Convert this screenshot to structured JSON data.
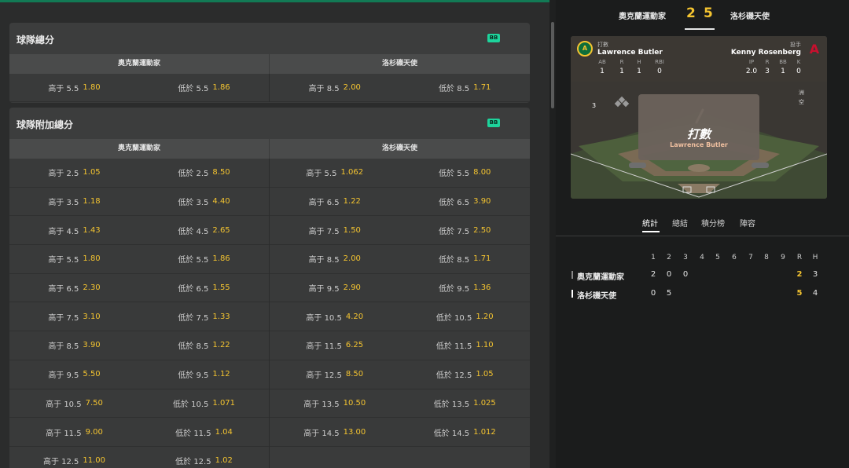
{
  "team_total": {
    "title": "球隊總分",
    "badge": "BB",
    "teams": [
      "奧克蘭運動家",
      "洛杉磯天使"
    ],
    "rows": [
      [
        {
          "label": "高于 5.5",
          "odd": "1.80"
        },
        {
          "label": "低於 5.5",
          "odd": "1.86"
        },
        {
          "label": "高于 8.5",
          "odd": "2.00"
        },
        {
          "label": "低於 8.5",
          "odd": "1.71"
        }
      ]
    ]
  },
  "team_extra_total": {
    "title": "球隊附加總分",
    "badge": "BB",
    "teams": [
      "奧克蘭運動家",
      "洛杉磯天使"
    ],
    "left_rows": [
      [
        {
          "label": "高于 2.5",
          "odd": "1.05"
        },
        {
          "label": "低於 2.5",
          "odd": "8.50"
        }
      ],
      [
        {
          "label": "高于 3.5",
          "odd": "1.18"
        },
        {
          "label": "低於 3.5",
          "odd": "4.40"
        }
      ],
      [
        {
          "label": "高于 4.5",
          "odd": "1.43"
        },
        {
          "label": "低於 4.5",
          "odd": "2.65"
        }
      ],
      [
        {
          "label": "高于 5.5",
          "odd": "1.80"
        },
        {
          "label": "低於 5.5",
          "odd": "1.86"
        }
      ],
      [
        {
          "label": "高于 6.5",
          "odd": "2.30"
        },
        {
          "label": "低於 6.5",
          "odd": "1.55"
        }
      ],
      [
        {
          "label": "高于 7.5",
          "odd": "3.10"
        },
        {
          "label": "低於 7.5",
          "odd": "1.33"
        }
      ],
      [
        {
          "label": "高于 8.5",
          "odd": "3.90"
        },
        {
          "label": "低於 8.5",
          "odd": "1.22"
        }
      ],
      [
        {
          "label": "高于 9.5",
          "odd": "5.50"
        },
        {
          "label": "低於 9.5",
          "odd": "1.12"
        }
      ],
      [
        {
          "label": "高于 10.5",
          "odd": "7.50"
        },
        {
          "label": "低於 10.5",
          "odd": "1.071"
        }
      ],
      [
        {
          "label": "高于 11.5",
          "odd": "9.00"
        },
        {
          "label": "低於 11.5",
          "odd": "1.04"
        }
      ],
      [
        {
          "label": "高于 12.5",
          "odd": "11.00"
        },
        {
          "label": "低於 12.5",
          "odd": "1.02"
        }
      ]
    ],
    "right_rows": [
      [
        {
          "label": "高于 5.5",
          "odd": "1.062"
        },
        {
          "label": "低於 5.5",
          "odd": "8.00"
        }
      ],
      [
        {
          "label": "高于 6.5",
          "odd": "1.22"
        },
        {
          "label": "低於 6.5",
          "odd": "3.90"
        }
      ],
      [
        {
          "label": "高于 7.5",
          "odd": "1.50"
        },
        {
          "label": "低於 7.5",
          "odd": "2.50"
        }
      ],
      [
        {
          "label": "高于 8.5",
          "odd": "2.00"
        },
        {
          "label": "低於 8.5",
          "odd": "1.71"
        }
      ],
      [
        {
          "label": "高于 9.5",
          "odd": "2.90"
        },
        {
          "label": "低於 9.5",
          "odd": "1.36"
        }
      ],
      [
        {
          "label": "高于 10.5",
          "odd": "4.20"
        },
        {
          "label": "低於 10.5",
          "odd": "1.20"
        }
      ],
      [
        {
          "label": "高于 11.5",
          "odd": "6.25"
        },
        {
          "label": "低於 11.5",
          "odd": "1.10"
        }
      ],
      [
        {
          "label": "高于 12.5",
          "odd": "8.50"
        },
        {
          "label": "低於 12.5",
          "odd": "1.05"
        }
      ],
      [
        {
          "label": "高于 13.5",
          "odd": "10.50"
        },
        {
          "label": "低於 13.5",
          "odd": "1.025"
        }
      ],
      [
        {
          "label": "高于 14.5",
          "odd": "13.00"
        },
        {
          "label": "低於 14.5",
          "odd": "1.012"
        }
      ]
    ]
  },
  "scoreboard": {
    "home_team": "奧克蘭運動家",
    "home_score": "2",
    "away_score": "5",
    "away_team": "洛杉磯天使"
  },
  "field": {
    "batter_role": "打數",
    "batter_name": "Lawrence Butler",
    "batter_stat_labels": [
      "AB",
      "R",
      "H",
      "RBI"
    ],
    "batter_stat_values": [
      "1",
      "1",
      "1",
      "0"
    ],
    "pitcher_role": "投手",
    "pitcher_name": "Kenny Rosenberg",
    "pitcher_stat_labels": [
      "IP",
      "R",
      "BB",
      "K"
    ],
    "pitcher_stat_values": [
      "2.0",
      "3",
      "1",
      "0"
    ],
    "left_side_label": "3",
    "right_side_label_1": "",
    "right_side_label_2": "",
    "right_top": "洲",
    "right_bottom": "空",
    "logo_a": "A",
    "logo_b": "A",
    "popup_title": "打數",
    "popup_sub": "Lawrence Butler"
  },
  "tabs": [
    "統計",
    "總結",
    "積分榜",
    "陣容"
  ],
  "box_score": {
    "innings": [
      "1",
      "2",
      "3",
      "4",
      "5",
      "6",
      "7",
      "8",
      "9",
      "R",
      "H"
    ],
    "teams": [
      {
        "name": "奧克蘭運動家",
        "bar": "#888888",
        "innings": [
          "2",
          "0",
          "0",
          "",
          "",
          "",
          "",
          "",
          ""
        ],
        "R": "2",
        "H": "3"
      },
      {
        "name": "洛杉磯天使",
        "bar": "#ffffff",
        "innings": [
          "0",
          "5",
          "",
          "",
          "",
          "",
          "",
          "",
          ""
        ],
        "R": "5",
        "H": "4"
      }
    ]
  },
  "colors": {
    "accent": "#127a55",
    "odds": "#f4c430",
    "badge": "#1dd49c"
  }
}
